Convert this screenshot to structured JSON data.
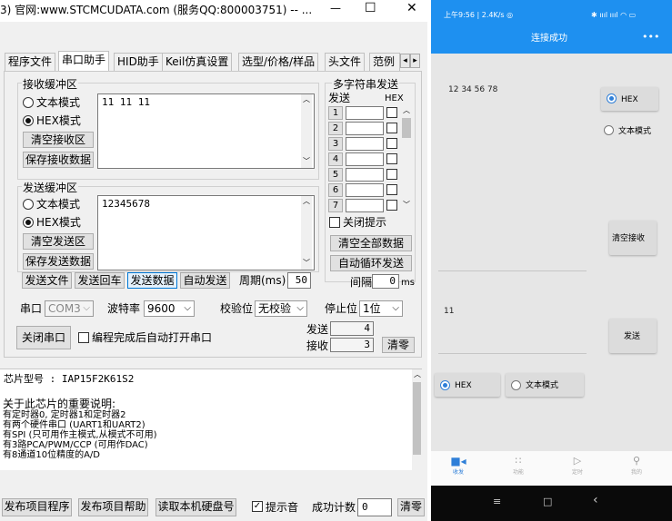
{
  "window": {
    "title": "3) 官网:www.STCMCUDATA.com  (服务QQ:800003751) -- ...",
    "min": "—",
    "max": "☐",
    "close": "✕"
  },
  "tabs": [
    "程序文件",
    "串口助手",
    "HID助手",
    "Keil仿真设置",
    "选型/价格/样品",
    "头文件",
    "范例"
  ],
  "recv": {
    "group": "接收缓冲区",
    "text_mode": "文本模式",
    "hex_mode": "HEX模式",
    "clear": "清空接收区",
    "save": "保存接收数据",
    "content": "11 11 11"
  },
  "send": {
    "group": "发送缓冲区",
    "text_mode": "文本模式",
    "hex_mode": "HEX模式",
    "clear": "清空发送区",
    "save": "保存发送数据",
    "content": "12345678"
  },
  "multi": {
    "title": "多字符串发送",
    "col_send": "发送",
    "col_hex": "HEX",
    "rows": [
      "1",
      "2",
      "3",
      "4",
      "5",
      "6",
      "7"
    ],
    "close_tip": "关闭提示",
    "clear_all": "清空全部数据",
    "auto_loop": "自动循环发送",
    "interval_label": "间隔",
    "interval_value": "0",
    "interval_unit": "ms"
  },
  "actions": {
    "send_file": "发送文件",
    "send_enter": "发送回车",
    "send_data": "发送数据",
    "auto_send": "自动发送",
    "period_label": "周期(ms)",
    "period_value": "50"
  },
  "serial": {
    "port_label": "串口",
    "port_value": "COM3",
    "baud_label": "波特率",
    "baud_value": "9600",
    "parity_label": "校验位",
    "parity_value": "无校验",
    "stop_label": "停止位",
    "stop_value": "1位",
    "close_port": "关闭串口",
    "auto_open": "编程完成后自动打开串口",
    "sent_label": "发送",
    "sent_value": "4",
    "recv_label": "接收",
    "recv_value": "3",
    "clear_count": "清零"
  },
  "chip": {
    "label": "芯片型号 : IAP15F2K61S2",
    "info_title": "关于此芯片的重要说明:",
    "info_lines": [
      "  有定时器0, 定时器1和定时器2",
      "  有两个硬件串口 (UART1和UART2)",
      "  有SPI (只可用作主模式,从模式不可用)",
      "  有3路PCA/PWM/CCP (可用作DAC)",
      "  有8通道10位精度的A/D"
    ]
  },
  "bottom": {
    "publish_prog": "发布项目程序",
    "publish_help": "发布项目帮助",
    "read_disk": "读取本机硬盘号",
    "sound_tip": "提示音",
    "success_label": "成功计数",
    "success_value": "0",
    "clear": "清零"
  },
  "phone": {
    "status_left": "上午9:56 | 2.4K/s ◎",
    "status_right": "✱ ıııl ıııl ◠ ▭",
    "title": "连接成功",
    "menu": "•••",
    "recv_text": "12  34  56  78",
    "hex_label": "HEX",
    "text_mode_label": "文本模式",
    "clear_recv": "清空接收",
    "send_text": "11",
    "send_btn": "发送",
    "nav": [
      "收发",
      "功能",
      "定时",
      "我的"
    ],
    "sys_nav": [
      "≡",
      "□",
      "‹"
    ],
    "accent": "#2f7fd8",
    "header_color": "#1e90f0"
  }
}
